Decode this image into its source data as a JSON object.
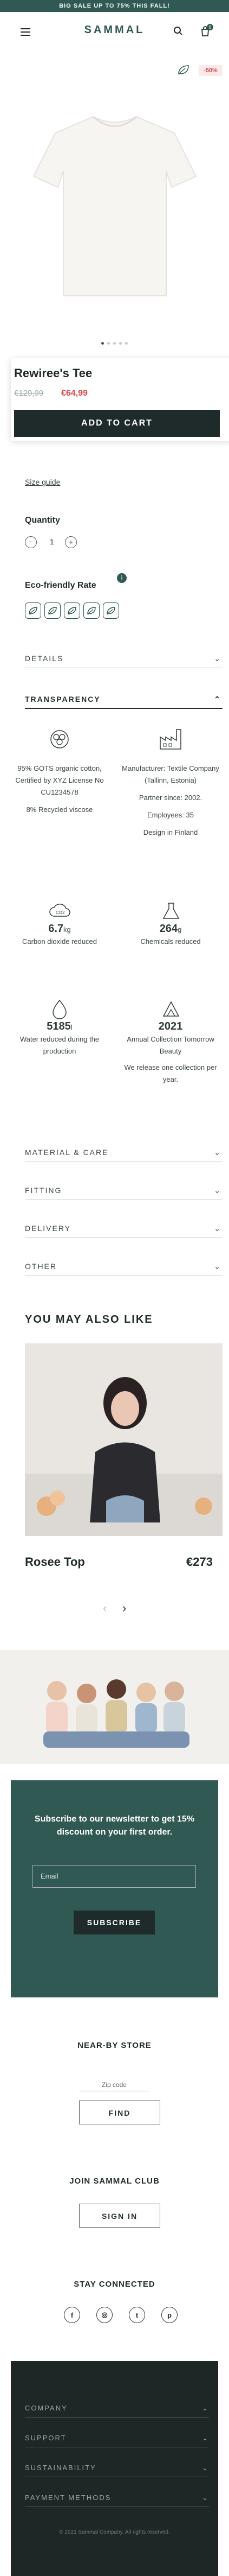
{
  "topbar": {
    "text": "BIG SALE UP TO 75% THIS FALL!"
  },
  "header": {
    "logo": "SAMMAL",
    "menu_icon": "menu-icon",
    "search_icon": "search-icon",
    "cart_icon": "cart-icon",
    "cart_count": "0"
  },
  "product": {
    "sale_badge": "-50%",
    "name": "Rewiree's Tee",
    "old_price": "€129,99",
    "new_price": "€64,99",
    "add_to_cart": "ADD TO CART",
    "size_guide": "Size guide",
    "quantity_label": "Quantity",
    "quantity": "1",
    "eco_label": "Eco-friendly Rate",
    "eco_info": "i",
    "gallery_dots": 5,
    "gallery_active": 1
  },
  "accordions": {
    "details": "DETAILS",
    "transparency": "TRANSPARENCY",
    "material": "MATERIAL & CARE",
    "fitting": "FITTING",
    "delivery": "DELIVERY",
    "other": "OTHER"
  },
  "transparency": {
    "material_text": "95% GOTS organic cotton, Certified by XYZ License No CU1234578",
    "material_text2": "8% Recycled viscose",
    "maker": "Manufacturer: Textile Company (Tallinn, Estonia)",
    "partner": "Partner since: 2002.",
    "employees": "Employees: 35",
    "design": "Design in Finland",
    "co2_value": "6.7",
    "co2_unit": "kg",
    "co2_label": "Carbon dioxide reduced",
    "chem_value": "264",
    "chem_unit": "g",
    "chem_label": "Chemicals reduced",
    "water_value": "5185",
    "water_unit": "l",
    "water_label": "Water reduced during the production",
    "year_value": "2021",
    "year_label": "Annual Collection Tomorrow Beauty",
    "year_note": "We release one collection per year."
  },
  "related": {
    "title": "YOU MAY ALSO LIKE",
    "item_name": "Rosee Top",
    "item_price": "€273"
  },
  "newsletter": {
    "text": "Subscribe to our newsletter to get 15% discount on your first order.",
    "placeholder": "Email",
    "button": "SUBSCRIBE"
  },
  "store": {
    "title": "NEAR-BY STORE",
    "zip_placeholder": "Zip code",
    "button": "FIND"
  },
  "club": {
    "title": "JOIN SAMMAL CLUB",
    "button": "SIGN IN"
  },
  "social": {
    "title": "STAY CONNECTED",
    "icons": [
      "facebook-icon",
      "instagram-icon",
      "twitter-icon",
      "pinterest-icon"
    ],
    "glyphs": [
      "f",
      "◎",
      "t",
      "p"
    ]
  },
  "footer": {
    "links": [
      "COMPANY",
      "SUPPORT",
      "SUSTAINABILITY",
      "PAYMENT METHODS"
    ],
    "copyright": "© 2021 Sammal Company. All rights reserved."
  },
  "colors": {
    "brand": "#2f5952",
    "sale": "#d44b4b",
    "dark": "#1f2a2a"
  }
}
